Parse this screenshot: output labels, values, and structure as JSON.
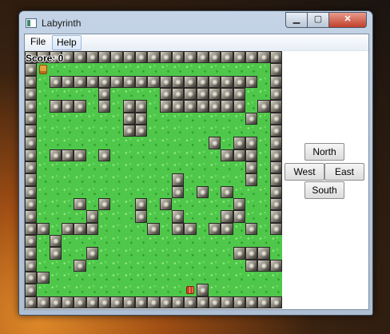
{
  "window": {
    "title": "Labyrinth",
    "controls": {
      "minimize": "▁",
      "maximize": "▢",
      "close": "✕"
    }
  },
  "menu": {
    "items": [
      "File",
      "Help"
    ],
    "hovered": "Help"
  },
  "score_text": "Score: 0",
  "controls": {
    "north": "North",
    "west": "West",
    "east": "East",
    "south": "South"
  },
  "maze": {
    "grid": [
      "#####################",
      "#P..................#",
      "#.#################.#",
      "#.....#....#######..#",
      "#.###.#.##.#######.##",
      "#.......##........#.#",
      "#.......##..........#",
      "#..............#.##.#",
      "#.###.#.........###.#",
      "#.................#.#",
      "#...........#.....#.#",
      "#...........#.#.#...#",
      "#...#.#..#.#.....#..#",
      "#....#...#..#...##..#",
      "##.###....#.##.##.#.#",
      "#.#...................",
      "#.#..#...........###.#",
      "#...#.............####",
      "##...................#",
      "#............E#......#",
      "#####################"
    ],
    "legend": {
      "#": "wall",
      ".": "floor",
      "P": "player",
      "E": "exit"
    }
  }
}
